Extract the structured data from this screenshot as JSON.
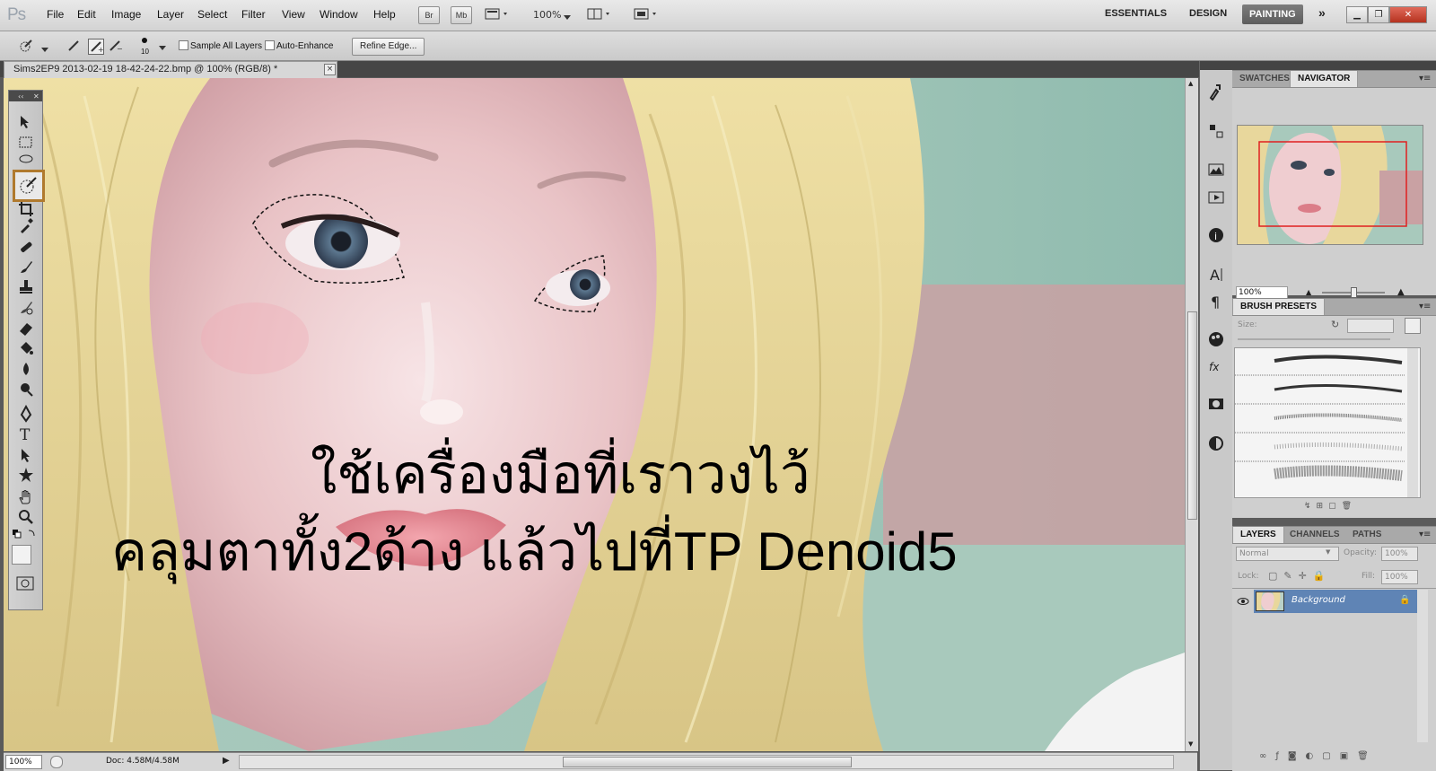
{
  "app": {
    "logo": "Ps",
    "menu": [
      "File",
      "Edit",
      "Image",
      "Layer",
      "Select",
      "Filter",
      "View",
      "Window",
      "Help"
    ],
    "bridge_button": "Br",
    "minibridge_button": "Mb",
    "zoom": "100%",
    "workspaces": [
      "ESSENTIALS",
      "DESIGN"
    ],
    "active_workspace": "PAINTING",
    "more": "»"
  },
  "options": {
    "brush_size": "10",
    "sample_all_layers": "Sample All Layers",
    "auto_enhance": "Auto-Enhance",
    "refine_edge": "Refine Edge..."
  },
  "document": {
    "tab_title": "Sims2EP9 2013-02-19 18-42-24-22.bmp @ 100% (RGB/8) *",
    "close": "×"
  },
  "overlay": {
    "line1": "ใช้เครื่องมือที่เราวงไว้",
    "line2": "คลุมตาทั้ง2ด้าง แล้วไปที่TP Denoid5"
  },
  "status": {
    "zoom": "100%",
    "doc": "Doc: 4.58M/4.58M"
  },
  "navigator": {
    "tabs": [
      "SWATCHES",
      "NAVIGATOR"
    ],
    "active_tab": "NAVIGATOR",
    "zoom": "100%"
  },
  "brush_presets": {
    "title": "BRUSH PRESETS",
    "size_label": "Size:"
  },
  "layers": {
    "tabs": [
      "LAYERS",
      "CHANNELS",
      "PATHS"
    ],
    "blend_mode": "Normal",
    "opacity_label": "Opacity:",
    "opacity_value": "100%",
    "lock_label": "Lock:",
    "fill_label": "Fill:",
    "fill_value": "100%",
    "layer_name": "Background"
  },
  "colors": {
    "accent_highlight": "#b07a2e",
    "selected_layer": "#5f84b5",
    "active_workspace_bg": "#6b6b6b"
  }
}
